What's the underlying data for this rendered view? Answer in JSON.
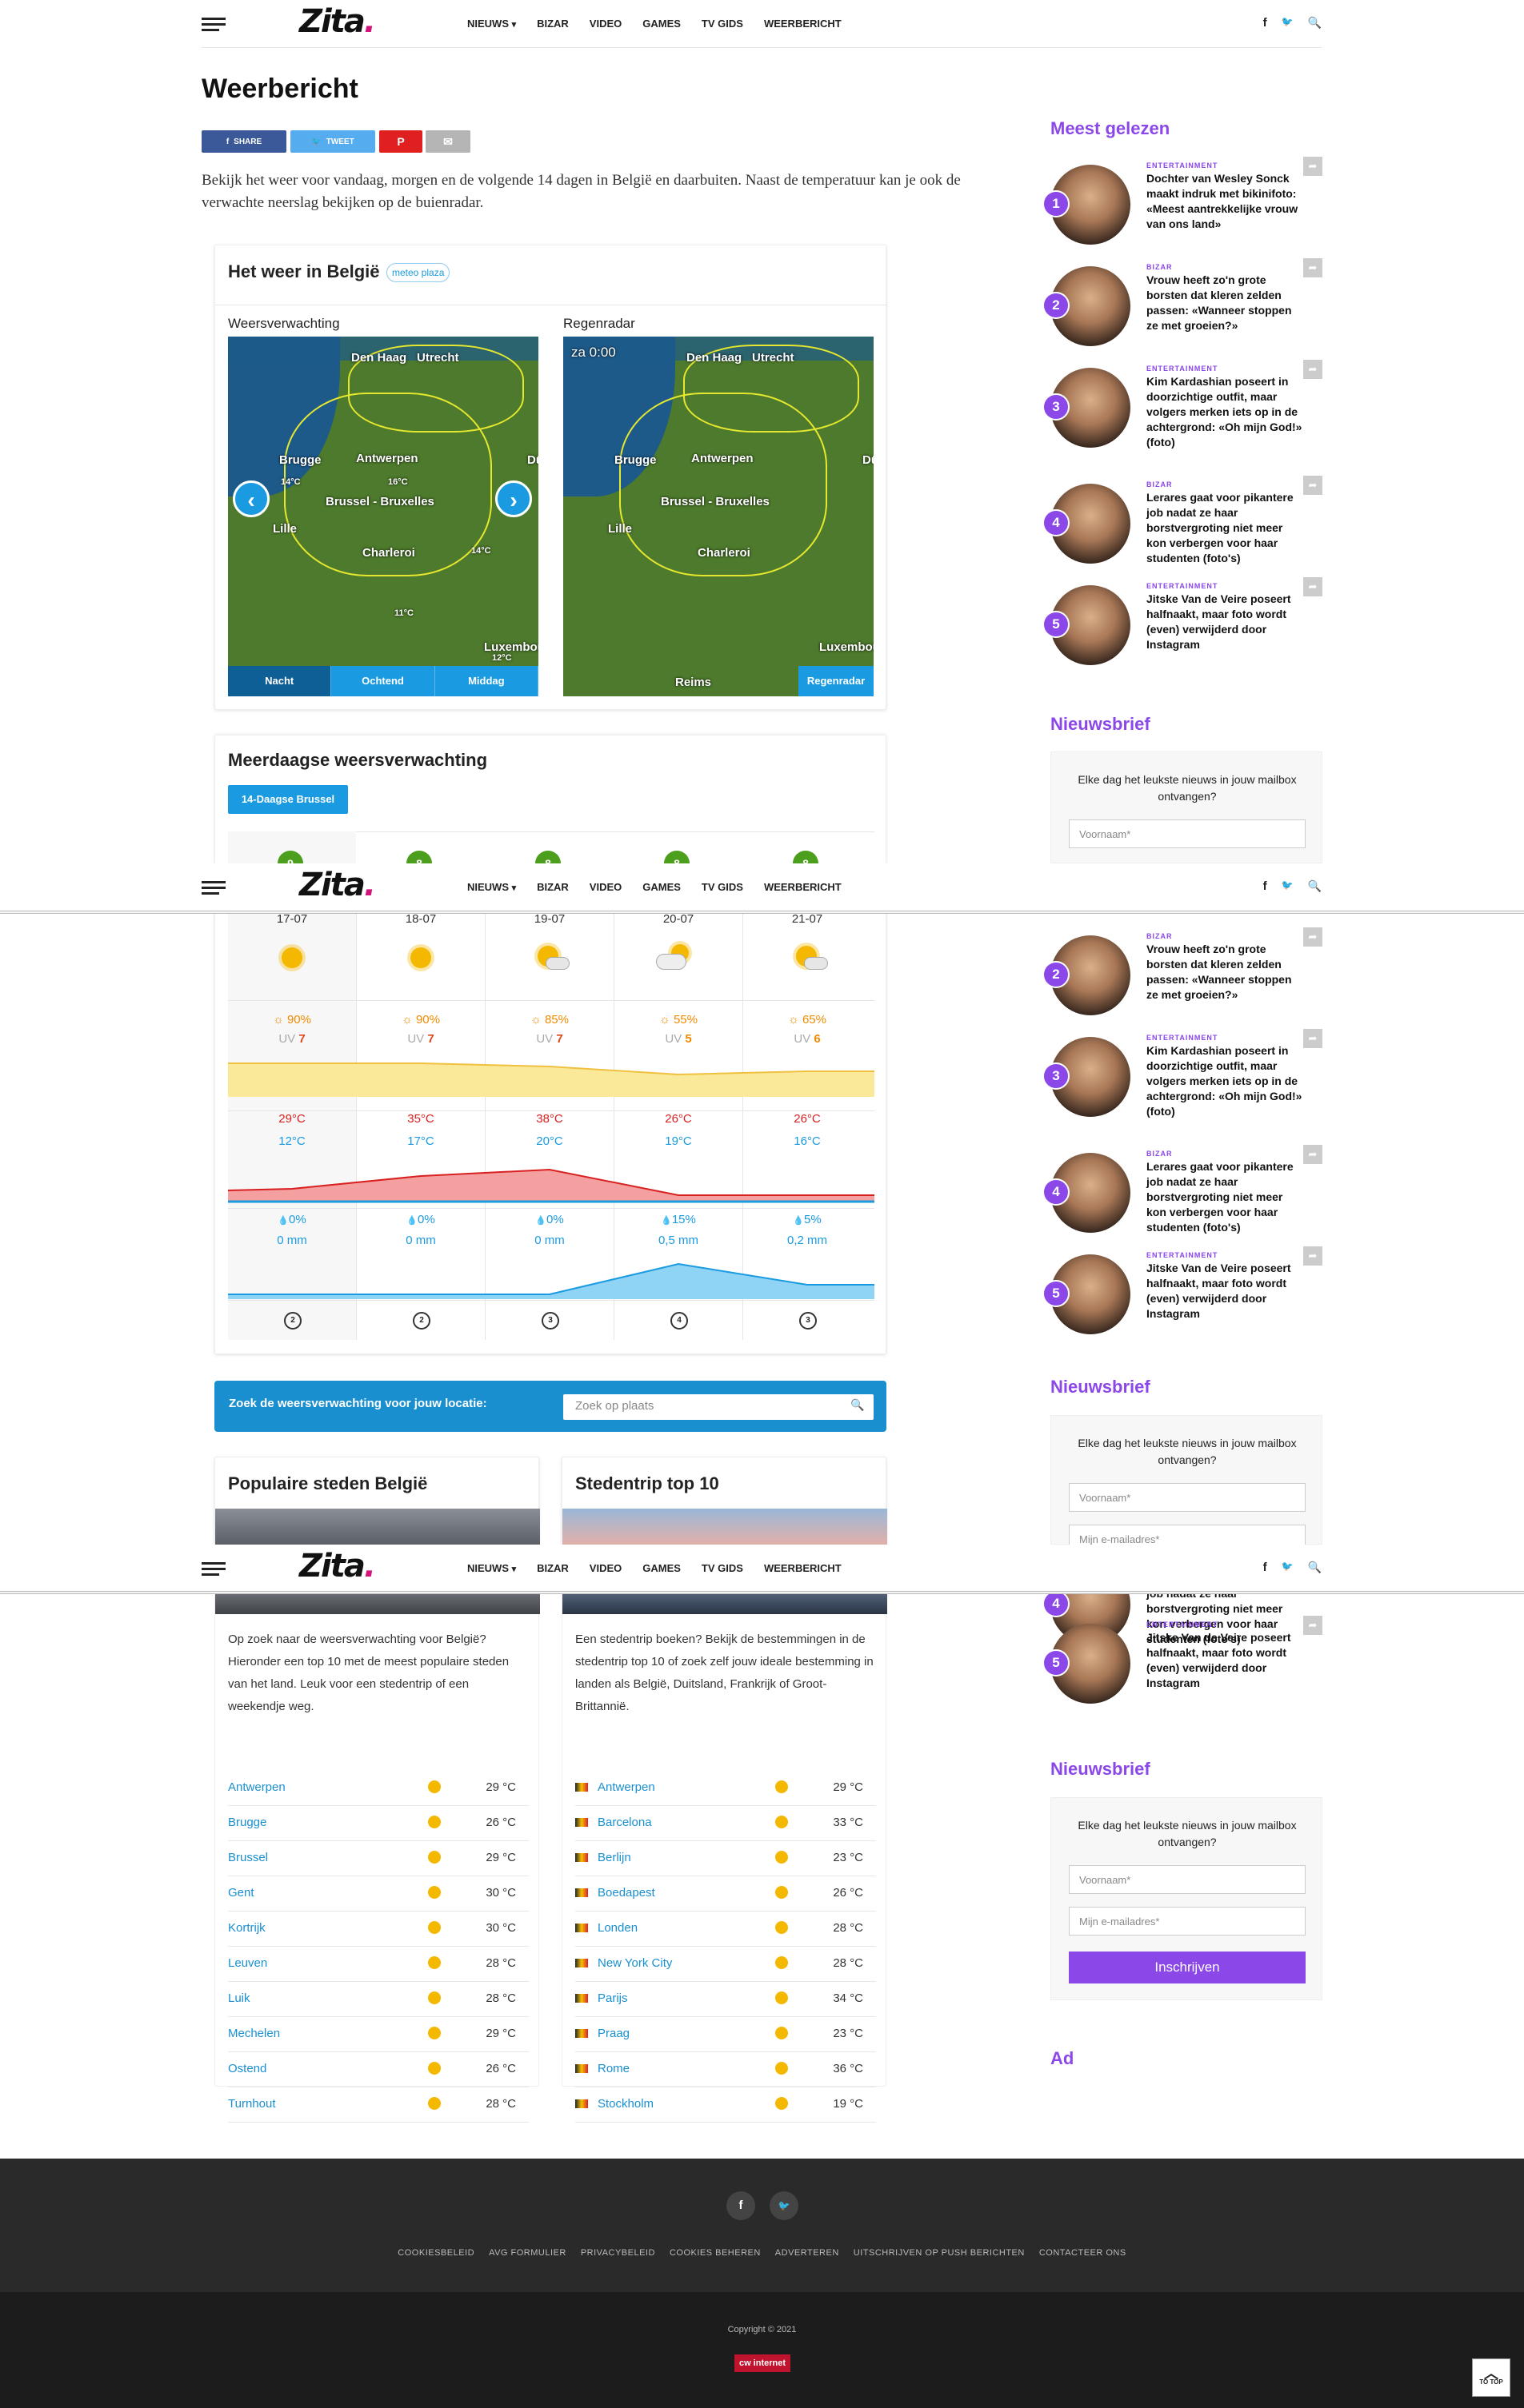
{
  "header": {
    "logo": "Zita",
    "logo_dot": ".",
    "nav": [
      "NIEUWS",
      "BIZAR",
      "VIDEO",
      "GAMES",
      "TV GIDS",
      "WEERBERICHT"
    ],
    "nav_caret": "▾",
    "social_fb": "f",
    "social_tw": "🐦",
    "search_icon": "🔍"
  },
  "page": {
    "title": "Weerbericht",
    "share": {
      "facebook": "SHARE",
      "twitter": "TWEET"
    },
    "intro": "Bekijk het weer voor vandaag, morgen en de volgende 14 dagen in België en daarbuiten. Naast de temperatuur kan je ook de verwachte neerslag bekijken op de buienradar."
  },
  "weather_widget": {
    "title": "Het weer in België",
    "brand": "meteo plaza",
    "left_label": "Weersverwachting",
    "right_label": "Regenradar",
    "radar_time": "za 0:00",
    "map_cities": [
      "Den Haag",
      "Utrecht",
      "Brugge",
      "Antwerpen",
      "Brussel - Bruxelles",
      "Lille",
      "Charleroi",
      "Luxembou",
      "Reims",
      "Dü"
    ],
    "temps": [
      "14°C",
      "16°C",
      "14°C",
      "11°C",
      "12°C"
    ],
    "tabs": [
      "Nacht",
      "Ochtend",
      "Middag"
    ],
    "radar_tab": "Regenradar"
  },
  "multiday": {
    "title": "Meerdaagse weersverwachting",
    "button": "14-Daagse Brussel",
    "scores": [
      "9",
      "8",
      "8",
      "8",
      "8"
    ],
    "days": [
      "17-07",
      "18-07",
      "19-07",
      "20-07",
      "21-07"
    ],
    "sun_pct": [
      "90%",
      "90%",
      "85%",
      "55%",
      "65%"
    ],
    "uv_label": "UV",
    "uv": [
      "7",
      "7",
      "7",
      "5",
      "6"
    ],
    "max": [
      "29°C",
      "35°C",
      "38°C",
      "26°C",
      "26°C"
    ],
    "min": [
      "12°C",
      "17°C",
      "20°C",
      "19°C",
      "16°C"
    ],
    "rain_pct": [
      "0%",
      "0%",
      "0%",
      "15%",
      "5%"
    ],
    "rain_mm": [
      "0 mm",
      "0 mm",
      "0 mm",
      "0,5 mm",
      "0,2 mm"
    ],
    "wind": [
      "2",
      "2",
      "3",
      "4",
      "3"
    ],
    "sun_icon": "☼",
    "drop_icon": "💧"
  },
  "search": {
    "label": "Zoek de weersverwachting voor jouw locatie:",
    "placeholder": "Zoek op plaats"
  },
  "popular": {
    "title": "Populaire steden België",
    "text": "Op zoek naar de weersverwachting voor België? Hieronder een top 10 met de meest populaire steden van het land. Leuk voor een stedentrip of een weekendje weg.",
    "cities": [
      {
        "name": "Antwerpen",
        "temp": "29 °C"
      },
      {
        "name": "Brugge",
        "temp": "26 °C"
      },
      {
        "name": "Brussel",
        "temp": "29 °C"
      },
      {
        "name": "Gent",
        "temp": "30 °C"
      },
      {
        "name": "Kortrijk",
        "temp": "30 °C"
      },
      {
        "name": "Leuven",
        "temp": "28 °C"
      },
      {
        "name": "Luik",
        "temp": "28 °C"
      },
      {
        "name": "Mechelen",
        "temp": "29 °C"
      },
      {
        "name": "Ostend",
        "temp": "26 °C"
      },
      {
        "name": "Turnhout",
        "temp": "28 °C"
      }
    ]
  },
  "trips": {
    "title": "Stedentrip top 10",
    "text": "Een stedentrip boeken? Bekijk de bestemmingen in de stedentrip top 10 of zoek zelf jouw ideale bestemming in landen als België, Duitsland, Frankrijk of Groot-Brittannië.",
    "cities": [
      {
        "name": "Antwerpen",
        "temp": "29 °C"
      },
      {
        "name": "Barcelona",
        "temp": "33 °C"
      },
      {
        "name": "Berlijn",
        "temp": "23 °C"
      },
      {
        "name": "Boedapest",
        "temp": "26 °C"
      },
      {
        "name": "Londen",
        "temp": "28 °C"
      },
      {
        "name": "New York City",
        "temp": "28 °C"
      },
      {
        "name": "Parijs",
        "temp": "34 °C"
      },
      {
        "name": "Praag",
        "temp": "23 °C"
      },
      {
        "name": "Rome",
        "temp": "36 °C"
      },
      {
        "name": "Stockholm",
        "temp": "19 °C"
      }
    ]
  },
  "sidebar": {
    "most_read": "Meest gelezen",
    "items": [
      {
        "n": "1",
        "cat": "ENTERTAINMENT",
        "title": "Dochter van Wesley Sonck maakt indruk met bikinifoto: «Meest aantrekkelijke vrouw van ons land»"
      },
      {
        "n": "2",
        "cat": "BIZAR",
        "title": "Vrouw heeft zo'n grote borsten dat kleren zelden passen: «Wanneer stoppen ze met groeien?»"
      },
      {
        "n": "3",
        "cat": "ENTERTAINMENT",
        "title": "Kim Kardashian poseert in doorzichtige outfit, maar volgers merken iets op in de achtergrond: «Oh mijn God!» (foto)"
      },
      {
        "n": "4",
        "cat": "BIZAR",
        "title": "Lerares gaat voor pikantere job nadat ze haar borstvergroting niet meer kon verbergen voor haar studenten (foto's)"
      },
      {
        "n": "5",
        "cat": "ENTERTAINMENT",
        "title": "Jitske Van de Veire poseert halfnaakt, maar foto wordt (even) verwijderd door Instagram"
      }
    ],
    "newsletter": "Nieuwsbrief",
    "nl_text": "Elke dag het leukste nieuws in jouw mailbox ontvangen?",
    "nl_name": "Voornaam*",
    "nl_email": "Mijn e-mailadres*",
    "nl_button": "Inschrijven",
    "ad": "Ad"
  },
  "footer": {
    "links": [
      "COOKIESBELEID",
      "AVG FORMULIER",
      "PRIVACYBELEID",
      "COOKIES BEHEREN",
      "ADVERTEREN",
      "UITSCHRIJVEN OP PUSH BERICHTEN",
      "CONTACTEER ONS"
    ],
    "copyright": "Copyright © 2021",
    "brand": "cw internet",
    "totop": "TO TOP"
  }
}
